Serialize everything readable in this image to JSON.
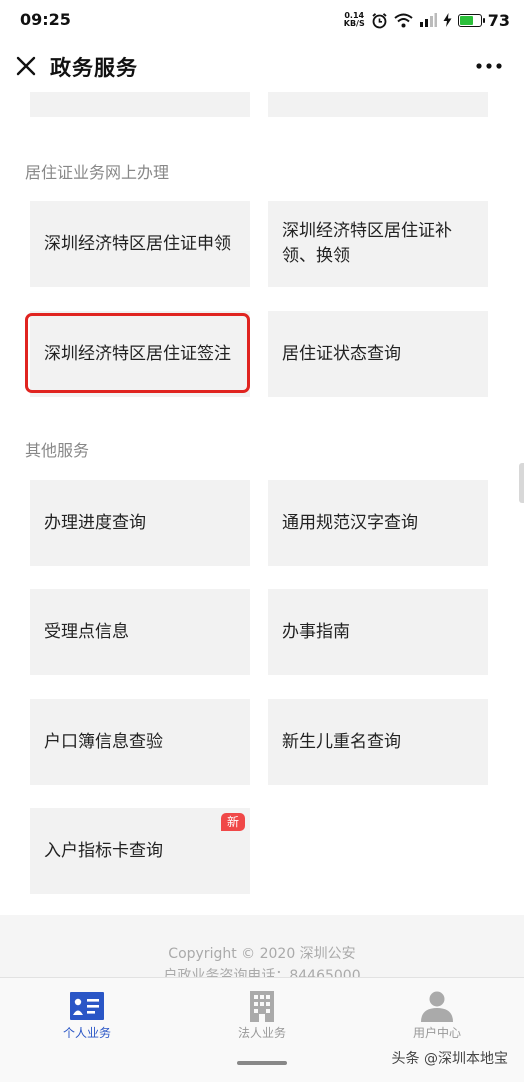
{
  "status_bar": {
    "time": "09:25",
    "net_speed_value": "0.14",
    "net_speed_unit": "KB/S",
    "battery_level": "73",
    "battery_fraction": 0.73
  },
  "header": {
    "title": "政务服务"
  },
  "sections": {
    "residence_permit": {
      "title": "居住证业务网上办理",
      "items": [
        {
          "label": "深圳经济特区居住证申领"
        },
        {
          "label": "深圳经济特区居住证补领、换领"
        },
        {
          "label": "深圳经济特区居住证签注"
        },
        {
          "label": "居住证状态查询"
        }
      ]
    },
    "other": {
      "title": "其他服务",
      "items": [
        {
          "label": "办理进度查询"
        },
        {
          "label": "通用规范汉字查询"
        },
        {
          "label": "受理点信息"
        },
        {
          "label": "办事指南"
        },
        {
          "label": "户口簿信息查验"
        },
        {
          "label": "新生儿重名查询"
        },
        {
          "label": "入户指标卡查询",
          "badge": "新"
        }
      ]
    }
  },
  "footer": {
    "copyright": "Copyright © 2020 深圳公安",
    "hotline": "户政业务咨询电话：84465000"
  },
  "tabbar": {
    "tabs": [
      {
        "label": "个人业务",
        "icon": "person-card-icon"
      },
      {
        "label": "法人业务",
        "icon": "building-icon"
      },
      {
        "label": "用户中心",
        "icon": "user-icon"
      }
    ],
    "active_index": 0
  },
  "watermark": "头条 @深圳本地宝",
  "colors": {
    "highlight_border": "#e02420",
    "active_tab": "#2a56c6",
    "tile_background": "#f2f2f2",
    "badge": "#f04848"
  }
}
